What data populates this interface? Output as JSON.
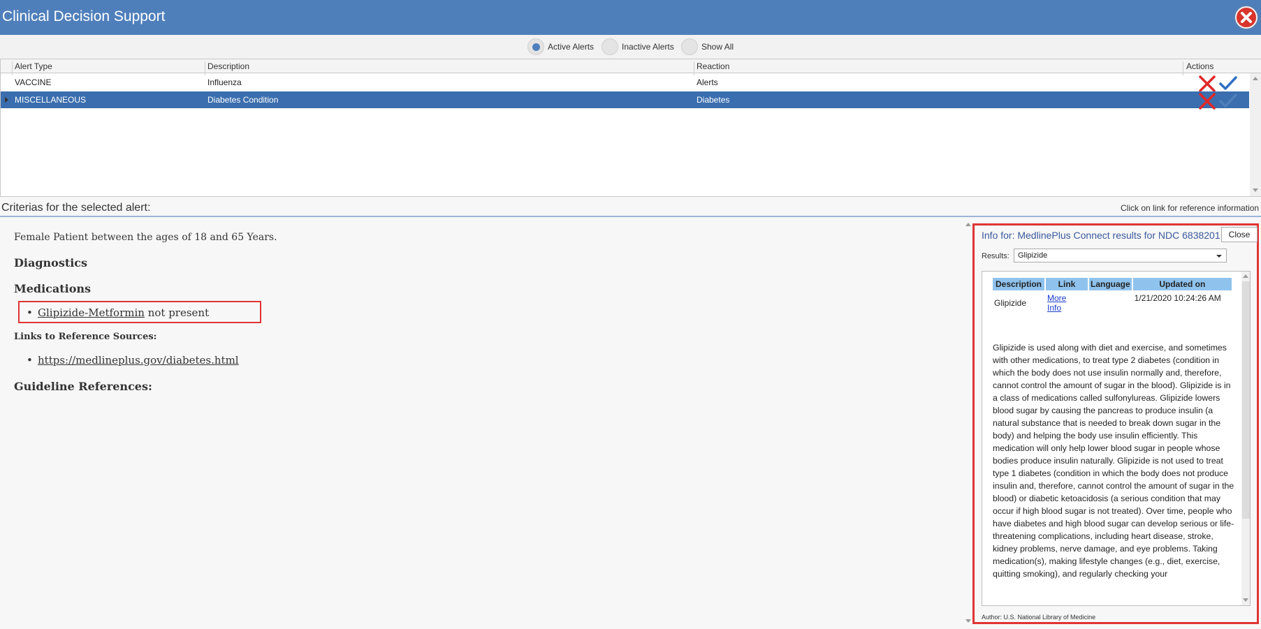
{
  "window": {
    "title": "Clinical Decision Support"
  },
  "filters": [
    {
      "label": "Active Alerts",
      "selected": true
    },
    {
      "label": "Inactive Alerts",
      "selected": false
    },
    {
      "label": "Show All",
      "selected": false
    }
  ],
  "grid": {
    "columns": [
      "Alert Type",
      "Description",
      "Reaction",
      "Actions"
    ],
    "rows": [
      {
        "type": "VACCINE",
        "description": "Influenza",
        "reaction": "Alerts",
        "selected": false
      },
      {
        "type": "MISCELLANEOUS",
        "description": "Diabetes Condition",
        "reaction": "Diabetes",
        "selected": true
      }
    ]
  },
  "criteria": {
    "label": "Criterias for the selected alert:",
    "hint": "Click on link for reference information",
    "patient": "Female Patient between the ages of 18 and 65 Years.",
    "diagnostics_heading": "Diagnostics",
    "medications_heading": "Medications",
    "medication_link": "Glipizide-Metformin",
    "medication_status": "not present",
    "links_heading": "Links to Reference Sources:",
    "reference_link": "https://medlineplus.gov/diabetes.html",
    "guideline_heading": "Guideline References:"
  },
  "info_panel": {
    "header": "Info for: MedlinePlus Connect results for NDC 6838201",
    "close_label": "Close",
    "results_label": "Results:",
    "results_value": "Glipizide",
    "table_headers": [
      "Description",
      "Link",
      "Language",
      "Updated on"
    ],
    "row": {
      "description": "Glipizide",
      "link_line1": "More",
      "link_line2": "Info",
      "language": "",
      "updated_on": "1/21/2020 10:24:26 AM"
    },
    "body": "Glipizide is used along with diet and exercise, and sometimes with other medications, to treat type 2 diabetes (condition in which the body does not use insulin normally and, therefore, cannot control the amount of sugar in the blood). Glipizide is in a class of medications called sulfonylureas. Glipizide lowers blood sugar by causing the pancreas to produce insulin (a natural substance that is needed to break down sugar in the body) and helping the body use insulin efficiently. This medication will only help lower blood sugar in people whose bodies produce insulin naturally. Glipizide is not used to treat type 1 diabetes (condition in which the body does not produce insulin and, therefore, cannot control the amount of sugar in the blood) or diabetic ketoacidosis (a serious condition that may occur if high blood sugar is not treated). Over time, people who have diabetes and high blood sugar can develop serious or life-threatening complications, including heart disease, stroke, kidney problems, nerve damage, and eye problems. Taking medication(s), making lifestyle changes (e.g., diet, exercise, quitting smoking), and regularly checking your",
    "author": "Author: U.S. National Library of Medicine"
  },
  "colors": {
    "titlebar": "#4f7fbb",
    "selected_row": "#3a6eae",
    "highlight_border": "#e03434",
    "dismiss": "#e02828",
    "accept": "#2f6fc4"
  }
}
